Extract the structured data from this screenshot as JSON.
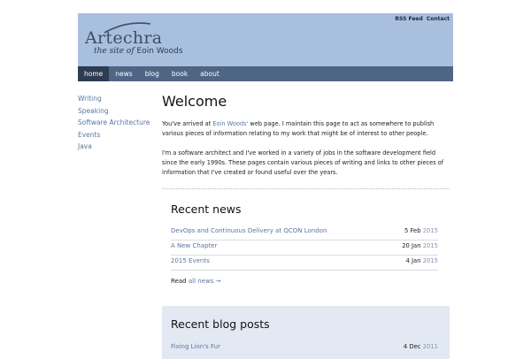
{
  "header": {
    "logo_name": "Artechra",
    "tagline_pre": "the site of",
    "tagline_name": "Eoin Woods",
    "top_links": [
      "RSS Feed",
      "Contact"
    ]
  },
  "nav": {
    "items": [
      "home",
      "news",
      "blog",
      "book",
      "about"
    ],
    "active": "home"
  },
  "sidebar": {
    "items": [
      "Writing",
      "Speaking",
      "Software Architecture",
      "Events",
      "Java"
    ]
  },
  "main": {
    "title": "Welcome",
    "intro_before": "You've arrived at ",
    "intro_link": "Eoin Woods'",
    "intro_after": " web page. I maintain this page to act as somewhere to publish various pieces of information relating to my work that might be of interest to other people.",
    "intro2": "I'm a software architect and I've worked in a variety of jobs in the software development field since the early 1990s. These pages contain various pieces of writing and links to other pieces of information that I've created or found useful over the years."
  },
  "news": {
    "heading": "Recent news",
    "items": [
      {
        "title": "DevOps and Continuous Delivery at QCON London",
        "date": "5 Feb",
        "year": "2015"
      },
      {
        "title": "A New Chapter",
        "date": "20 Jan",
        "year": "2015"
      },
      {
        "title": "2015 Events",
        "date": "4 Jan",
        "year": "2015"
      }
    ],
    "read_prefix": "Read ",
    "read_link": "all news →"
  },
  "blog": {
    "heading": "Recent blog posts",
    "items": [
      {
        "title": "Fixing Lion's Fur",
        "date": "4 Dec",
        "year": "2011"
      }
    ]
  },
  "colors": {
    "banner": "#a8bfde",
    "nav": "#4e6584",
    "nav_active": "#2d3c52",
    "link": "#5a75a3",
    "blog_bg": "#e3e9f3"
  }
}
